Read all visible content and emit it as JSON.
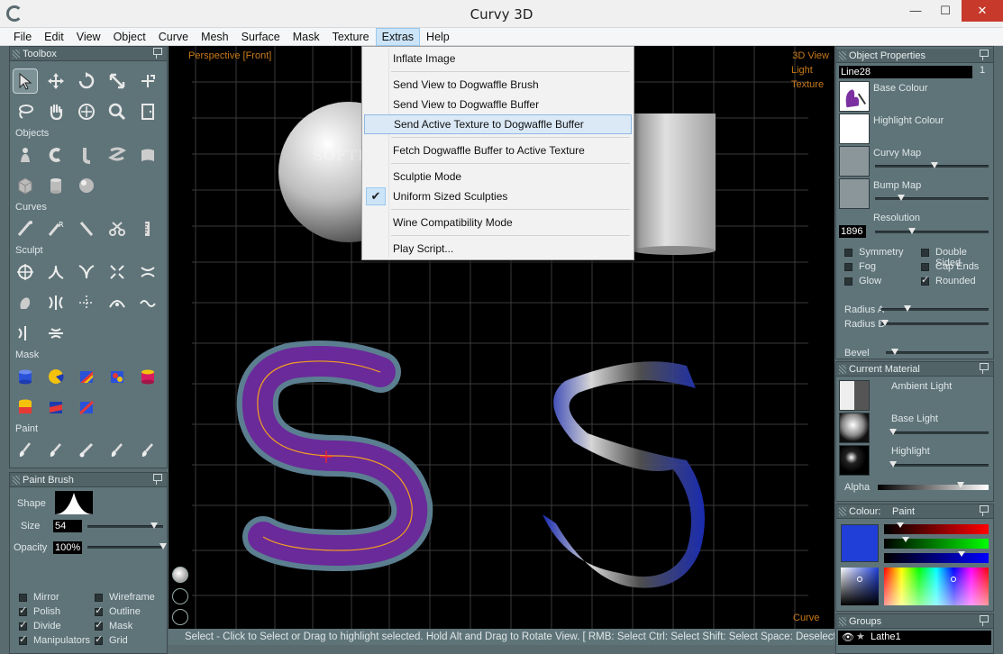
{
  "window": {
    "title": "Curvy 3D",
    "min": "—",
    "max": "☐",
    "close": "✕"
  },
  "menubar": [
    "File",
    "Edit",
    "View",
    "Object",
    "Curve",
    "Mesh",
    "Surface",
    "Mask",
    "Texture",
    "Extras",
    "Help"
  ],
  "extras_menu": [
    {
      "label": "Inflate Image"
    },
    {
      "label": "Send View to Dogwaffle Brush"
    },
    {
      "label": "Send View to Dogwaffle Buffer"
    },
    {
      "label": "Send Active Texture to Dogwaffle Buffer",
      "highlighted": true
    },
    {
      "label": "Fetch Dogwaffle Buffer to Active Texture"
    },
    {
      "label": "Sculptie Mode"
    },
    {
      "label": "Uniform Sized Sculpties",
      "checked": true
    },
    {
      "label": "Wine Compatibility Mode"
    },
    {
      "label": "Play Script..."
    }
  ],
  "toolbox": {
    "title": "Toolbox",
    "sections": {
      "objects": "Objects",
      "curves": "Curves",
      "sculpt": "Sculpt",
      "mask": "Mask",
      "paint": "Paint"
    }
  },
  "paint_brush": {
    "title": "Paint Brush",
    "shape_label": "Shape",
    "size_label": "Size",
    "size_value": "54",
    "opacity_label": "Opacity",
    "opacity_value": "100%",
    "checks": [
      {
        "label": "Mirror",
        "on": false
      },
      {
        "label": "Wireframe",
        "on": false
      },
      {
        "label": "Polish",
        "on": true
      },
      {
        "label": "Outline",
        "on": true
      },
      {
        "label": "Divide",
        "on": true
      },
      {
        "label": "Mask",
        "on": true
      },
      {
        "label": "Manipulators",
        "on": true
      },
      {
        "label": "Grid",
        "on": true
      }
    ]
  },
  "viewport": {
    "label": "Perspective [Front]",
    "right_labels": [
      "3D View",
      "Light",
      "Texture"
    ],
    "bottom_label": "Curve",
    "watermark": "SOFTPEDIA"
  },
  "status": "Select - Click to Select or Drag to highlight selected. Hold Alt and Drag to Rotate View. [ RMB: Select   Ctrl: Select   Shift: Select   Space: Deselect",
  "object_properties": {
    "title": "Object Properties",
    "name": "Line28",
    "index": "1",
    "base_colour": "Base Colour",
    "highlight_colour": "Highlight Colour",
    "curvy_map": "Curvy Map",
    "bump_map": "Bump Map",
    "resolution": "Resolution",
    "resolution_value": "1896",
    "checks": [
      {
        "label": "Symmetry",
        "on": false
      },
      {
        "label": "Double Sided",
        "on": false
      },
      {
        "label": "Fog",
        "on": false
      },
      {
        "label": "Cap Ends",
        "on": false
      },
      {
        "label": "Glow",
        "on": false
      },
      {
        "label": "Rounded",
        "on": true
      }
    ],
    "radius_a": "Radius A",
    "radius_b": "Radius B",
    "bevel": "Bevel"
  },
  "current_material": {
    "title": "Current Material",
    "ambient": "Ambient Light",
    "base": "Base Light",
    "highlight": "Highlight",
    "alpha": "Alpha"
  },
  "colour": {
    "title": "Colour:",
    "mode": "Paint",
    "swatch": "#1f3fd8"
  },
  "groups": {
    "title": "Groups",
    "item": "Lathe1"
  }
}
